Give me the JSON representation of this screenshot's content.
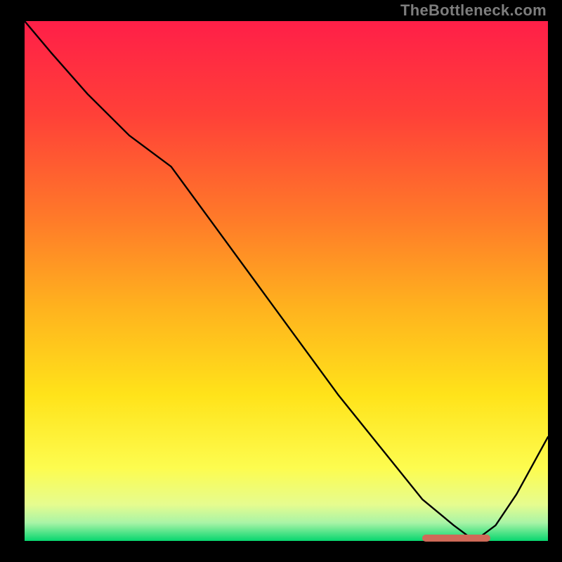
{
  "watermark": "TheBottleneck.com",
  "colors": {
    "frame": "#000000",
    "watermark": "#7d7d7d",
    "line": "#000000",
    "marker": "#cf6a58",
    "gradient_stops": [
      {
        "offset": 0.0,
        "color": "#ff1f48"
      },
      {
        "offset": 0.18,
        "color": "#ff4038"
      },
      {
        "offset": 0.38,
        "color": "#ff7a29"
      },
      {
        "offset": 0.55,
        "color": "#ffb21e"
      },
      {
        "offset": 0.72,
        "color": "#ffe31a"
      },
      {
        "offset": 0.86,
        "color": "#fdfc4f"
      },
      {
        "offset": 0.93,
        "color": "#e6fc8f"
      },
      {
        "offset": 0.965,
        "color": "#a9f4a6"
      },
      {
        "offset": 1.0,
        "color": "#07d66f"
      }
    ]
  },
  "chart_data": {
    "type": "line",
    "title": "",
    "xlabel": "",
    "ylabel": "",
    "xlim": [
      0,
      100
    ],
    "ylim": [
      0,
      100
    ],
    "grid": false,
    "legend": false,
    "x": [
      0,
      5,
      12,
      20,
      28,
      36,
      44,
      52,
      60,
      68,
      76,
      82,
      86,
      90,
      94,
      100
    ],
    "values": [
      100,
      94,
      86,
      78,
      72,
      61,
      50,
      39,
      28,
      18,
      8,
      3,
      0,
      3,
      9,
      20
    ],
    "marker_band": {
      "x_start": 76,
      "x_end": 89,
      "y": 0.6
    },
    "notes": "Single black curve over a vertical red→yellow→green gradient. Values estimated from plot: y≈100 at left edge, a kink near x≈28 where slope steepens, minimum y≈0 near x≈86, rising to y≈20 at right edge. A small coral marker strip sits at the valley bottom."
  }
}
